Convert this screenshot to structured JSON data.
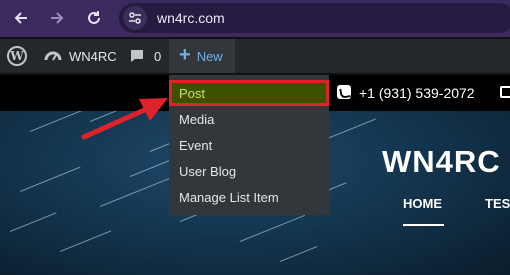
{
  "browser": {
    "url": "wn4rc.com",
    "back_icon": "arrow-left-icon",
    "forward_icon": "arrow-right-icon",
    "reload_icon": "reload-icon",
    "site_info_icon": "tune-icon"
  },
  "admin_bar": {
    "site_name": "WN4RC",
    "comments_count": "0",
    "new_label": "New"
  },
  "new_menu": {
    "items": [
      "Post",
      "Media",
      "Event",
      "User Blog",
      "Manage List Item"
    ],
    "highlighted": "Post"
  },
  "site": {
    "phone": "+1 (931) 539-2072",
    "title": "WN4RC",
    "menu": [
      "HOME",
      "TES"
    ]
  },
  "colors": {
    "browser_bar": "#3a2a5e",
    "admin_bar": "#23282d",
    "accent_blue": "#72aee6",
    "annotation_red": "#e0232a"
  }
}
